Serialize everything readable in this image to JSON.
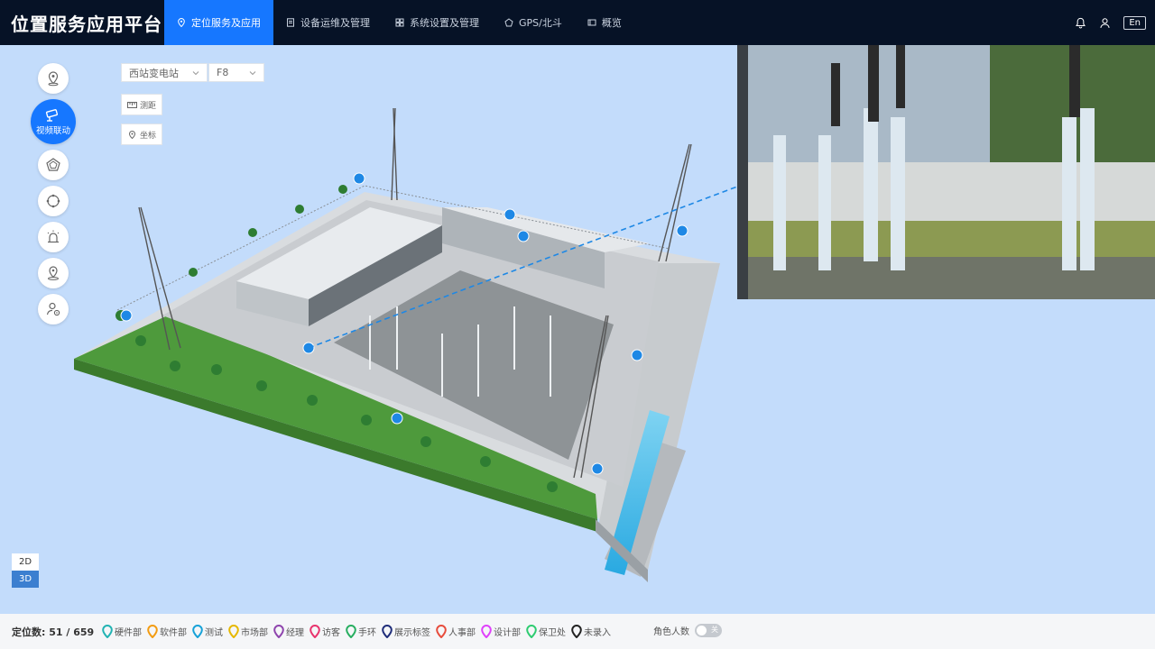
{
  "header": {
    "title": "位置服务应用平台",
    "nav": [
      {
        "label": "定位服务及应用",
        "icon": "location-pin-icon",
        "active": true
      },
      {
        "label": "设备运维及管理",
        "icon": "document-icon",
        "active": false
      },
      {
        "label": "系统设置及管理",
        "icon": "grid-icon",
        "active": false
      },
      {
        "label": "GPS/北斗",
        "icon": "satellite-icon",
        "active": false
      },
      {
        "label": "概览",
        "icon": "overview-icon",
        "active": false
      }
    ],
    "lang": "En"
  },
  "rail": {
    "video_label": "视频联动"
  },
  "controls": {
    "station": "西站变电站",
    "floor": "F8",
    "measure": "测距",
    "coords": "坐标"
  },
  "view": {
    "v2d": "2D",
    "v3d": "3D",
    "active": "3D"
  },
  "footer": {
    "count": "定位数: 51 / 659",
    "legend": [
      {
        "label": "硬件部",
        "color": "#22b3b3"
      },
      {
        "label": "软件部",
        "color": "#f39c12"
      },
      {
        "label": "测试",
        "color": "#17a2d8"
      },
      {
        "label": "市场部",
        "color": "#e6b800"
      },
      {
        "label": "经理",
        "color": "#8e44ad"
      },
      {
        "label": "访客",
        "color": "#e8336d"
      },
      {
        "label": "手环",
        "color": "#27ae60"
      },
      {
        "label": "展示标签",
        "color": "#1f2d7a"
      },
      {
        "label": "人事部",
        "color": "#e74c3c"
      },
      {
        "label": "设计部",
        "color": "#e040fb"
      },
      {
        "label": "保卫处",
        "color": "#2ecc71"
      },
      {
        "label": "未录入",
        "color": "#222222"
      }
    ],
    "role_count": "角色人数",
    "toggle": "关"
  }
}
